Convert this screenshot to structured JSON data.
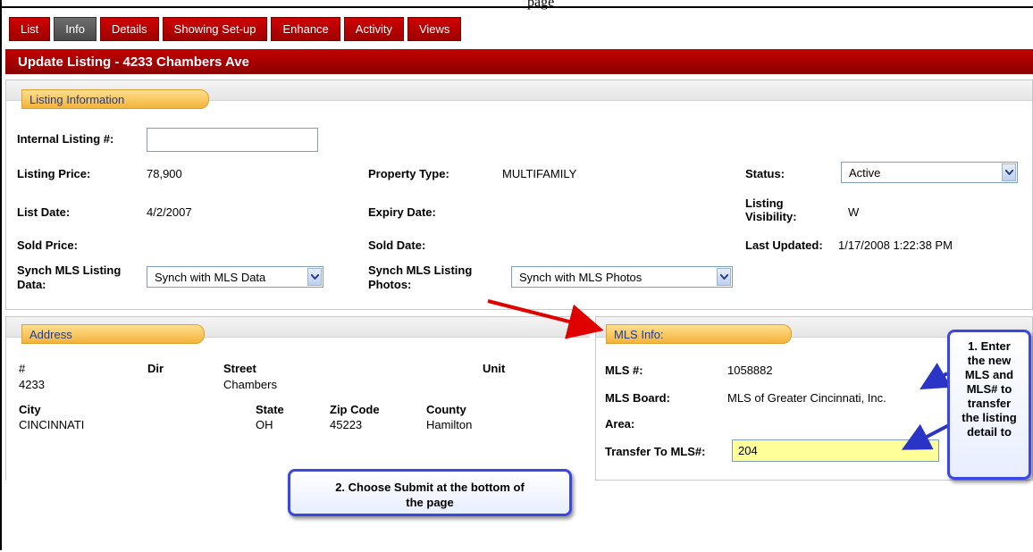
{
  "stray_text": "page",
  "tabs": [
    "List",
    "Info",
    "Details",
    "Showing Set-up",
    "Enhance",
    "Activity",
    "Views"
  ],
  "title": "Update Listing - 4233 Chambers Ave",
  "listing_info": {
    "section_label": "Listing Information",
    "internal_listing_label": "Internal Listing #:",
    "internal_listing_value": "",
    "listing_price_label": "Listing Price:",
    "listing_price_value": "78,900",
    "property_type_label": "Property Type:",
    "property_type_value": "MULTIFAMILY",
    "status_label": "Status:",
    "status_value": "Active",
    "list_date_label": "List Date:",
    "list_date_value": "4/2/2007",
    "expiry_date_label": "Expiry Date:",
    "listing_visibility_label_1": "Listing",
    "listing_visibility_label_2": "Visibility:",
    "listing_visibility_value": "W",
    "sold_price_label": "Sold Price:",
    "sold_date_label": "Sold Date:",
    "last_updated_label": "Last Updated:",
    "last_updated_value": "1/17/2008 1:22:38 PM",
    "synch_data_label_1": "Synch MLS Listing",
    "synch_data_label_2": "Data:",
    "synch_data_value": "Synch with MLS Data",
    "synch_photos_label_1": "Synch MLS Listing",
    "synch_photos_label_2": "Photos:",
    "synch_photos_value": "Synch with MLS Photos"
  },
  "address": {
    "section_label": "Address",
    "num_label": "#",
    "num_value": "4233",
    "dir_label": "Dir",
    "street_label": "Street",
    "street_value": "Chambers",
    "unit_label": "Unit",
    "city_label": "City",
    "city_value": "CINCINNATI",
    "state_label": "State",
    "state_value": "OH",
    "zip_label": "Zip Code",
    "zip_value": "45223",
    "county_label": "County",
    "county_value": "Hamilton"
  },
  "mls_info": {
    "section_label": "MLS Info:",
    "mls_num_label": "MLS #:",
    "mls_num_value": "1058882",
    "mls_board_label": "MLS Board:",
    "mls_board_value": "MLS of Greater Cincinnati, Inc.",
    "area_label": "Area:",
    "transfer_label": "Transfer To MLS#:",
    "transfer_value": "204"
  },
  "callouts": {
    "one": [
      "1. Enter",
      "the new",
      "MLS and",
      "MLS# to",
      "transfer",
      "the listing",
      "detail to"
    ],
    "two_line1": "2. Choose Submit at the bottom of",
    "two_line2": "the page"
  },
  "colors": {
    "tab_red": "#c00000",
    "tab_active": "#5a5a5a",
    "section_tab": "#f3b33b",
    "callout_border": "#3a47e0",
    "highlight_input": "#ffff99",
    "arrow_red": "#e00000",
    "arrow_blue": "#2a35c8"
  },
  "icons": [
    "dropdown-arrow-icon"
  ]
}
